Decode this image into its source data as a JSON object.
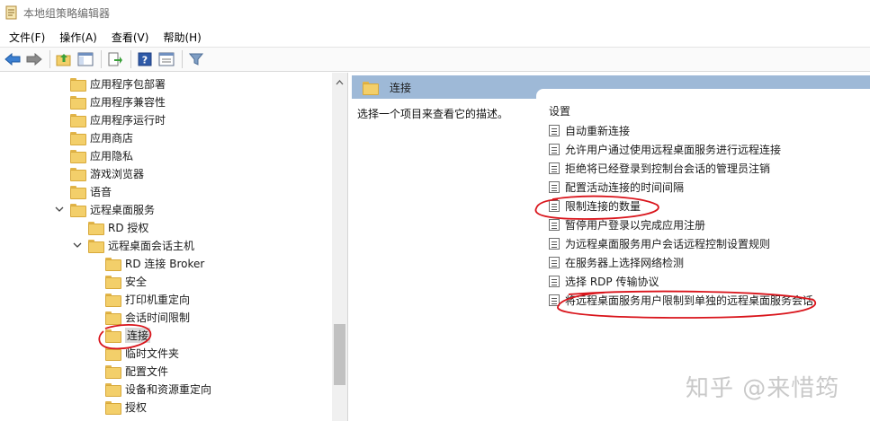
{
  "window": {
    "title": "本地组策略编辑器"
  },
  "menu": [
    "文件(F)",
    "操作(A)",
    "查看(V)",
    "帮助(H)"
  ],
  "toolbar": [
    "back-icon",
    "forward-icon",
    "up-folder-icon",
    "show-hide-tree-icon",
    "export-list-icon",
    "help-icon",
    "properties-icon",
    "filter-icon"
  ],
  "tree": [
    {
      "label": "应用程序包部署",
      "level": 3
    },
    {
      "label": "应用程序兼容性",
      "level": 3
    },
    {
      "label": "应用程序运行时",
      "level": 3
    },
    {
      "label": "应用商店",
      "level": 3
    },
    {
      "label": "应用隐私",
      "level": 3
    },
    {
      "label": "游戏浏览器",
      "level": 3
    },
    {
      "label": "语音",
      "level": 3
    },
    {
      "label": "远程桌面服务",
      "level": 3,
      "expanded": true
    },
    {
      "label": "RD 授权",
      "level": 4
    },
    {
      "label": "远程桌面会话主机",
      "level": 4,
      "expanded": true
    },
    {
      "label": "RD 连接 Broker",
      "level": 5
    },
    {
      "label": "安全",
      "level": 5
    },
    {
      "label": "打印机重定向",
      "level": 5
    },
    {
      "label": "会话时间限制",
      "level": 5
    },
    {
      "label": "连接",
      "level": 5,
      "selected": true
    },
    {
      "label": "临时文件夹",
      "level": 5
    },
    {
      "label": "配置文件",
      "level": 5
    },
    {
      "label": "设备和资源重定向",
      "level": 5
    },
    {
      "label": "授权",
      "level": 5
    }
  ],
  "right": {
    "header": "连接",
    "description": "选择一个项目来查看它的描述。",
    "settings_header": "设置",
    "settings": [
      "自动重新连接",
      "允许用户通过使用远程桌面服务进行远程连接",
      "拒绝将已经登录到控制台会话的管理员注销",
      "配置活动连接的时间间隔",
      "限制连接的数量",
      "暂停用户登录以完成应用注册",
      "为远程桌面服务用户会话远程控制设置规则",
      "在服务器上选择网络检测",
      "选择 RDP 传输协议",
      "将远程桌面服务用户限制到单独的远程桌面服务会话"
    ]
  },
  "watermark": "知乎 @来惜筠",
  "colors": {
    "header_bg": "#9eb9d7",
    "annotation": "#d9141b",
    "folder": "#f3cf6a"
  }
}
